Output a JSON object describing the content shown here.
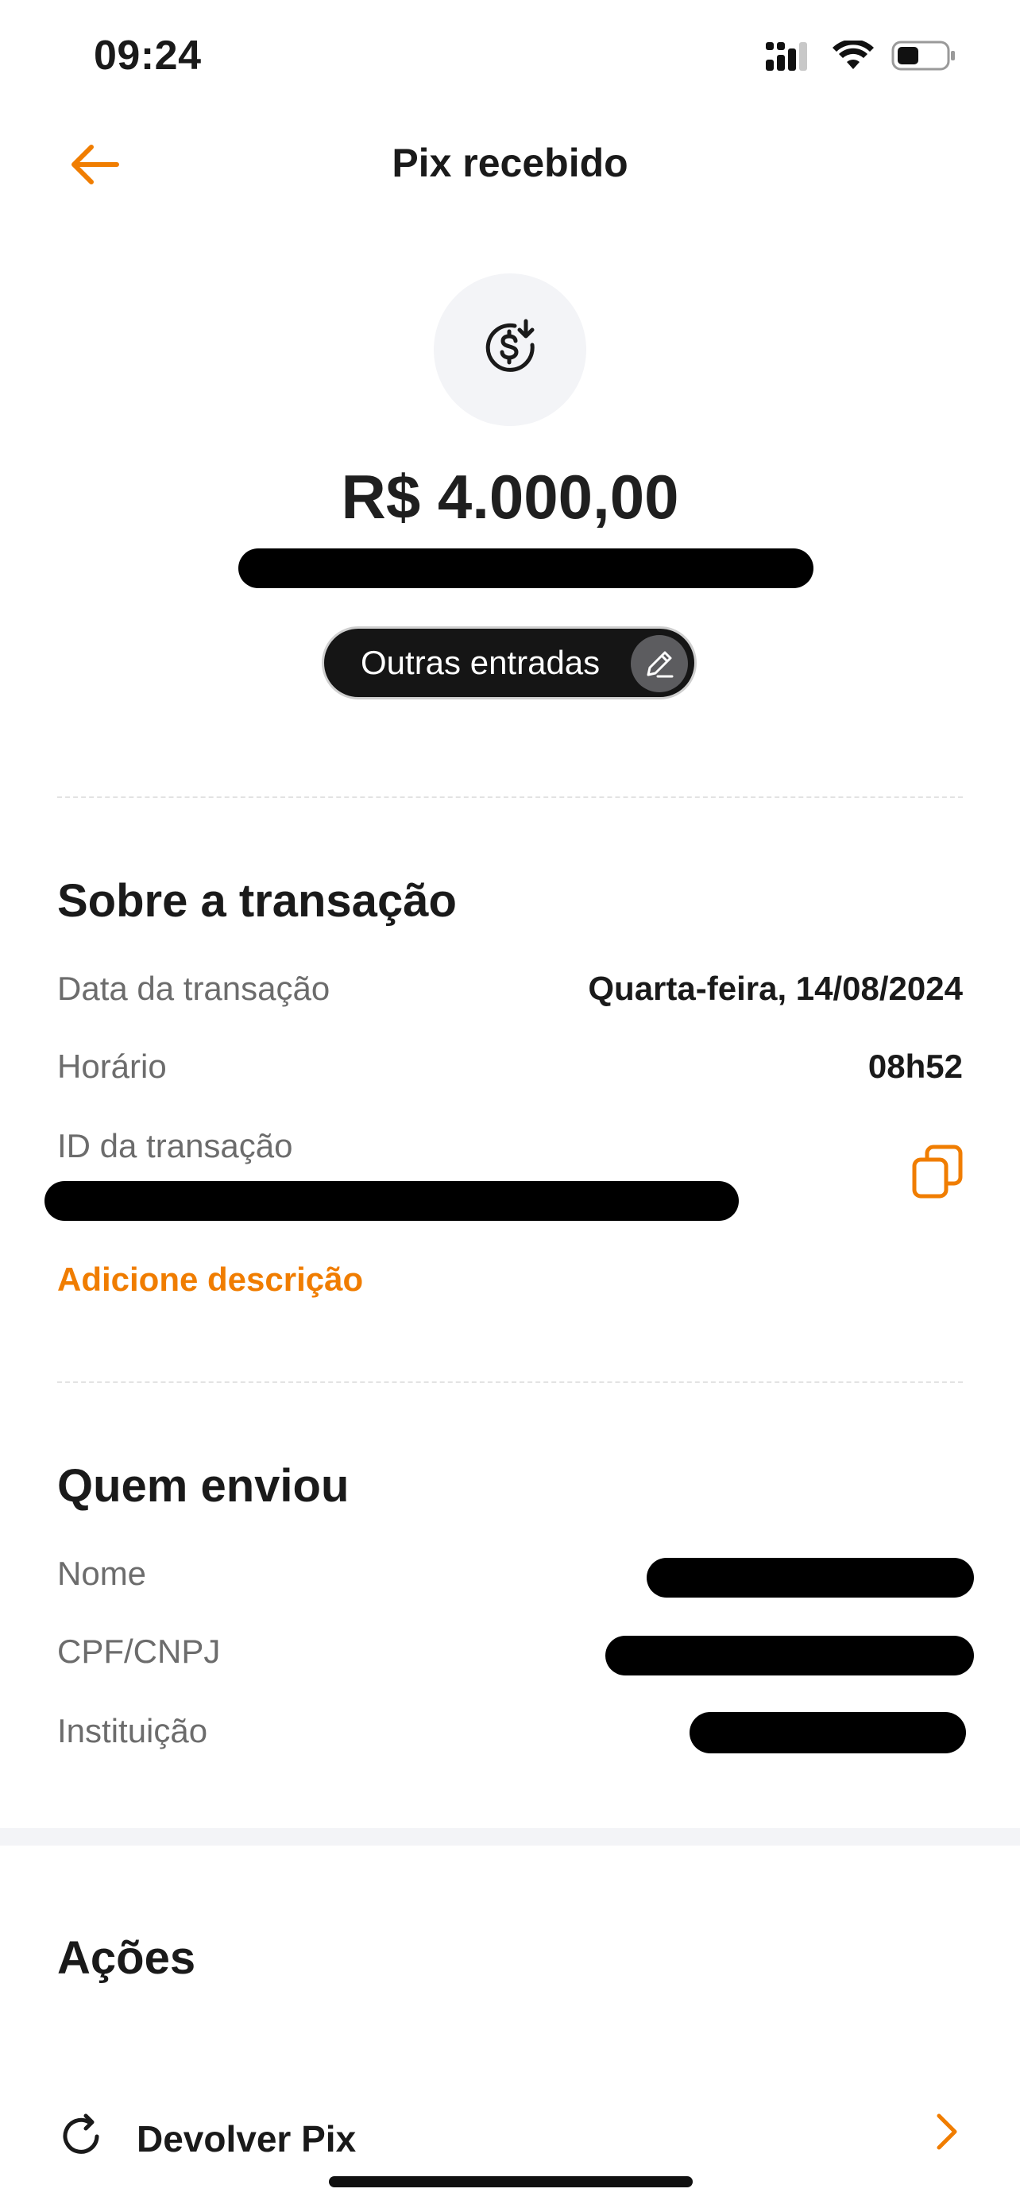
{
  "status_bar": {
    "time": "09:24",
    "icons": [
      "signal-icon",
      "wifi-icon",
      "battery-icon"
    ]
  },
  "header": {
    "title": "Pix recebido",
    "back_icon": "arrow-left-icon"
  },
  "summary": {
    "icon": "dollar-receive-icon",
    "amount": "R$ 4.000,00",
    "category": "Outras entradas",
    "category_edit_icon": "pencil-icon"
  },
  "transaction": {
    "title": "Sobre a transação",
    "date_label": "Data da transação",
    "date_value": "Quarta-feira, 14/08/2024",
    "time_label": "Horário",
    "time_value": "08h52",
    "id_label": "ID da transação",
    "copy_icon": "copy-icon",
    "add_description": "Adicione descrição"
  },
  "sender": {
    "title": "Quem enviou",
    "name_label": "Nome",
    "doc_label": "CPF/CNPJ",
    "institution_label": "Instituição"
  },
  "actions": {
    "title": "Ações",
    "items": [
      {
        "label": "Devolver Pix",
        "icon": "refresh-icon"
      }
    ]
  },
  "colors": {
    "accent": "#f07d00",
    "text": "#1a1a1a",
    "muted": "#6c6c6c",
    "icon_bg": "#f3f4f7"
  }
}
